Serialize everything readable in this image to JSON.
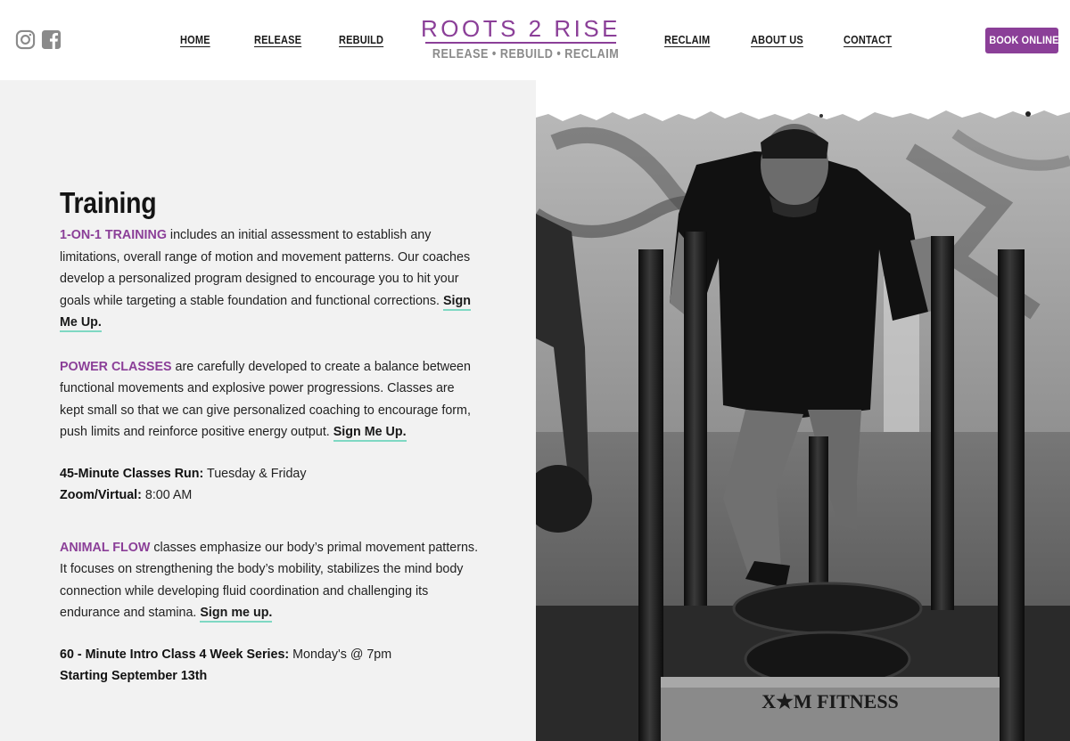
{
  "header": {
    "social": {
      "instagram_icon": "instagram-icon",
      "facebook_icon": "facebook-icon"
    },
    "nav": {
      "home": "HOME",
      "release": "RELEASE",
      "rebuild": "REBUILD",
      "reclaim": "RECLAIM",
      "about": "ABOUT US",
      "contact": "CONTACT"
    },
    "logo": {
      "main": "ROOTS 2 RISE",
      "tagline": "RELEASE • REBUILD • RECLAIM"
    },
    "book_button": "BOOK ONLINE"
  },
  "main": {
    "title": "Training",
    "one_on_one": {
      "label": "1-ON-1 TRAINING",
      "text": " includes an initial assessment to establish any limitations, overall range of motion and movement patterns. Our coaches develop a personalized program designed to encourage you to hit your goals while targeting a stable foundation and functional corrections. ",
      "link": "Sign Me Up."
    },
    "power": {
      "label": "POWER CLASSES",
      "text": " are carefully developed to create a balance between functional movements and explosive power progressions. Classes are kept small so that we can give personalized coaching to encourage form, push limits and reinforce positive energy output. ",
      "link": "Sign Me Up."
    },
    "schedule": {
      "classes_label": "45-Minute Classes Run:",
      "classes_value": " Tuesday & Friday",
      "zoom_label": "Zoom/Virtual:",
      "zoom_value": " 8:00 AM"
    },
    "animal_flow": {
      "label": "ANIMAL FLOW",
      "text": " classes emphasize our body’s primal movement patterns. It focuses on strengthening the body’s mobility, stabilizes the mind body connection while developing fluid coordination and challenging its endurance and stamina. ",
      "link": "Sign me up."
    },
    "intro": {
      "series_label": "60 - Minute Intro Class 4 Week Series:",
      "series_value": " Monday's @ 7pm",
      "start": "Starting September 13th"
    }
  },
  "photo": {
    "sled_brand": "X★M FITNESS"
  },
  "colors": {
    "accent": "#8b3f98",
    "link_underline": "#7fd8c3",
    "panel_bg": "#f2f2f2"
  }
}
